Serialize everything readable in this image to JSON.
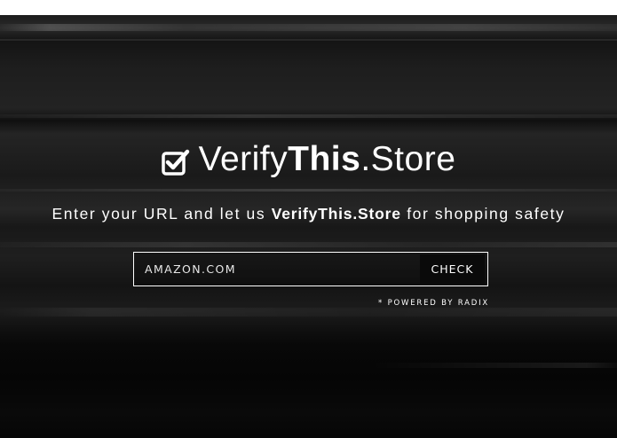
{
  "brand": {
    "prefix": "Verify",
    "bold": "This",
    "suffix": ".Store",
    "icon": "checkbox-checked-icon"
  },
  "tagline": {
    "before": "Enter your URL and let us ",
    "bold": "VerifyThis.Store",
    "after": " for shopping safety"
  },
  "search": {
    "value": "AMAZON.COM",
    "placeholder": "",
    "button_label": "CHECK"
  },
  "footer_note": "* POWERED BY RADIX",
  "colors": {
    "text": "#ffffff",
    "background": "#1a1a1a",
    "button_bg": "#0a0a0a"
  }
}
